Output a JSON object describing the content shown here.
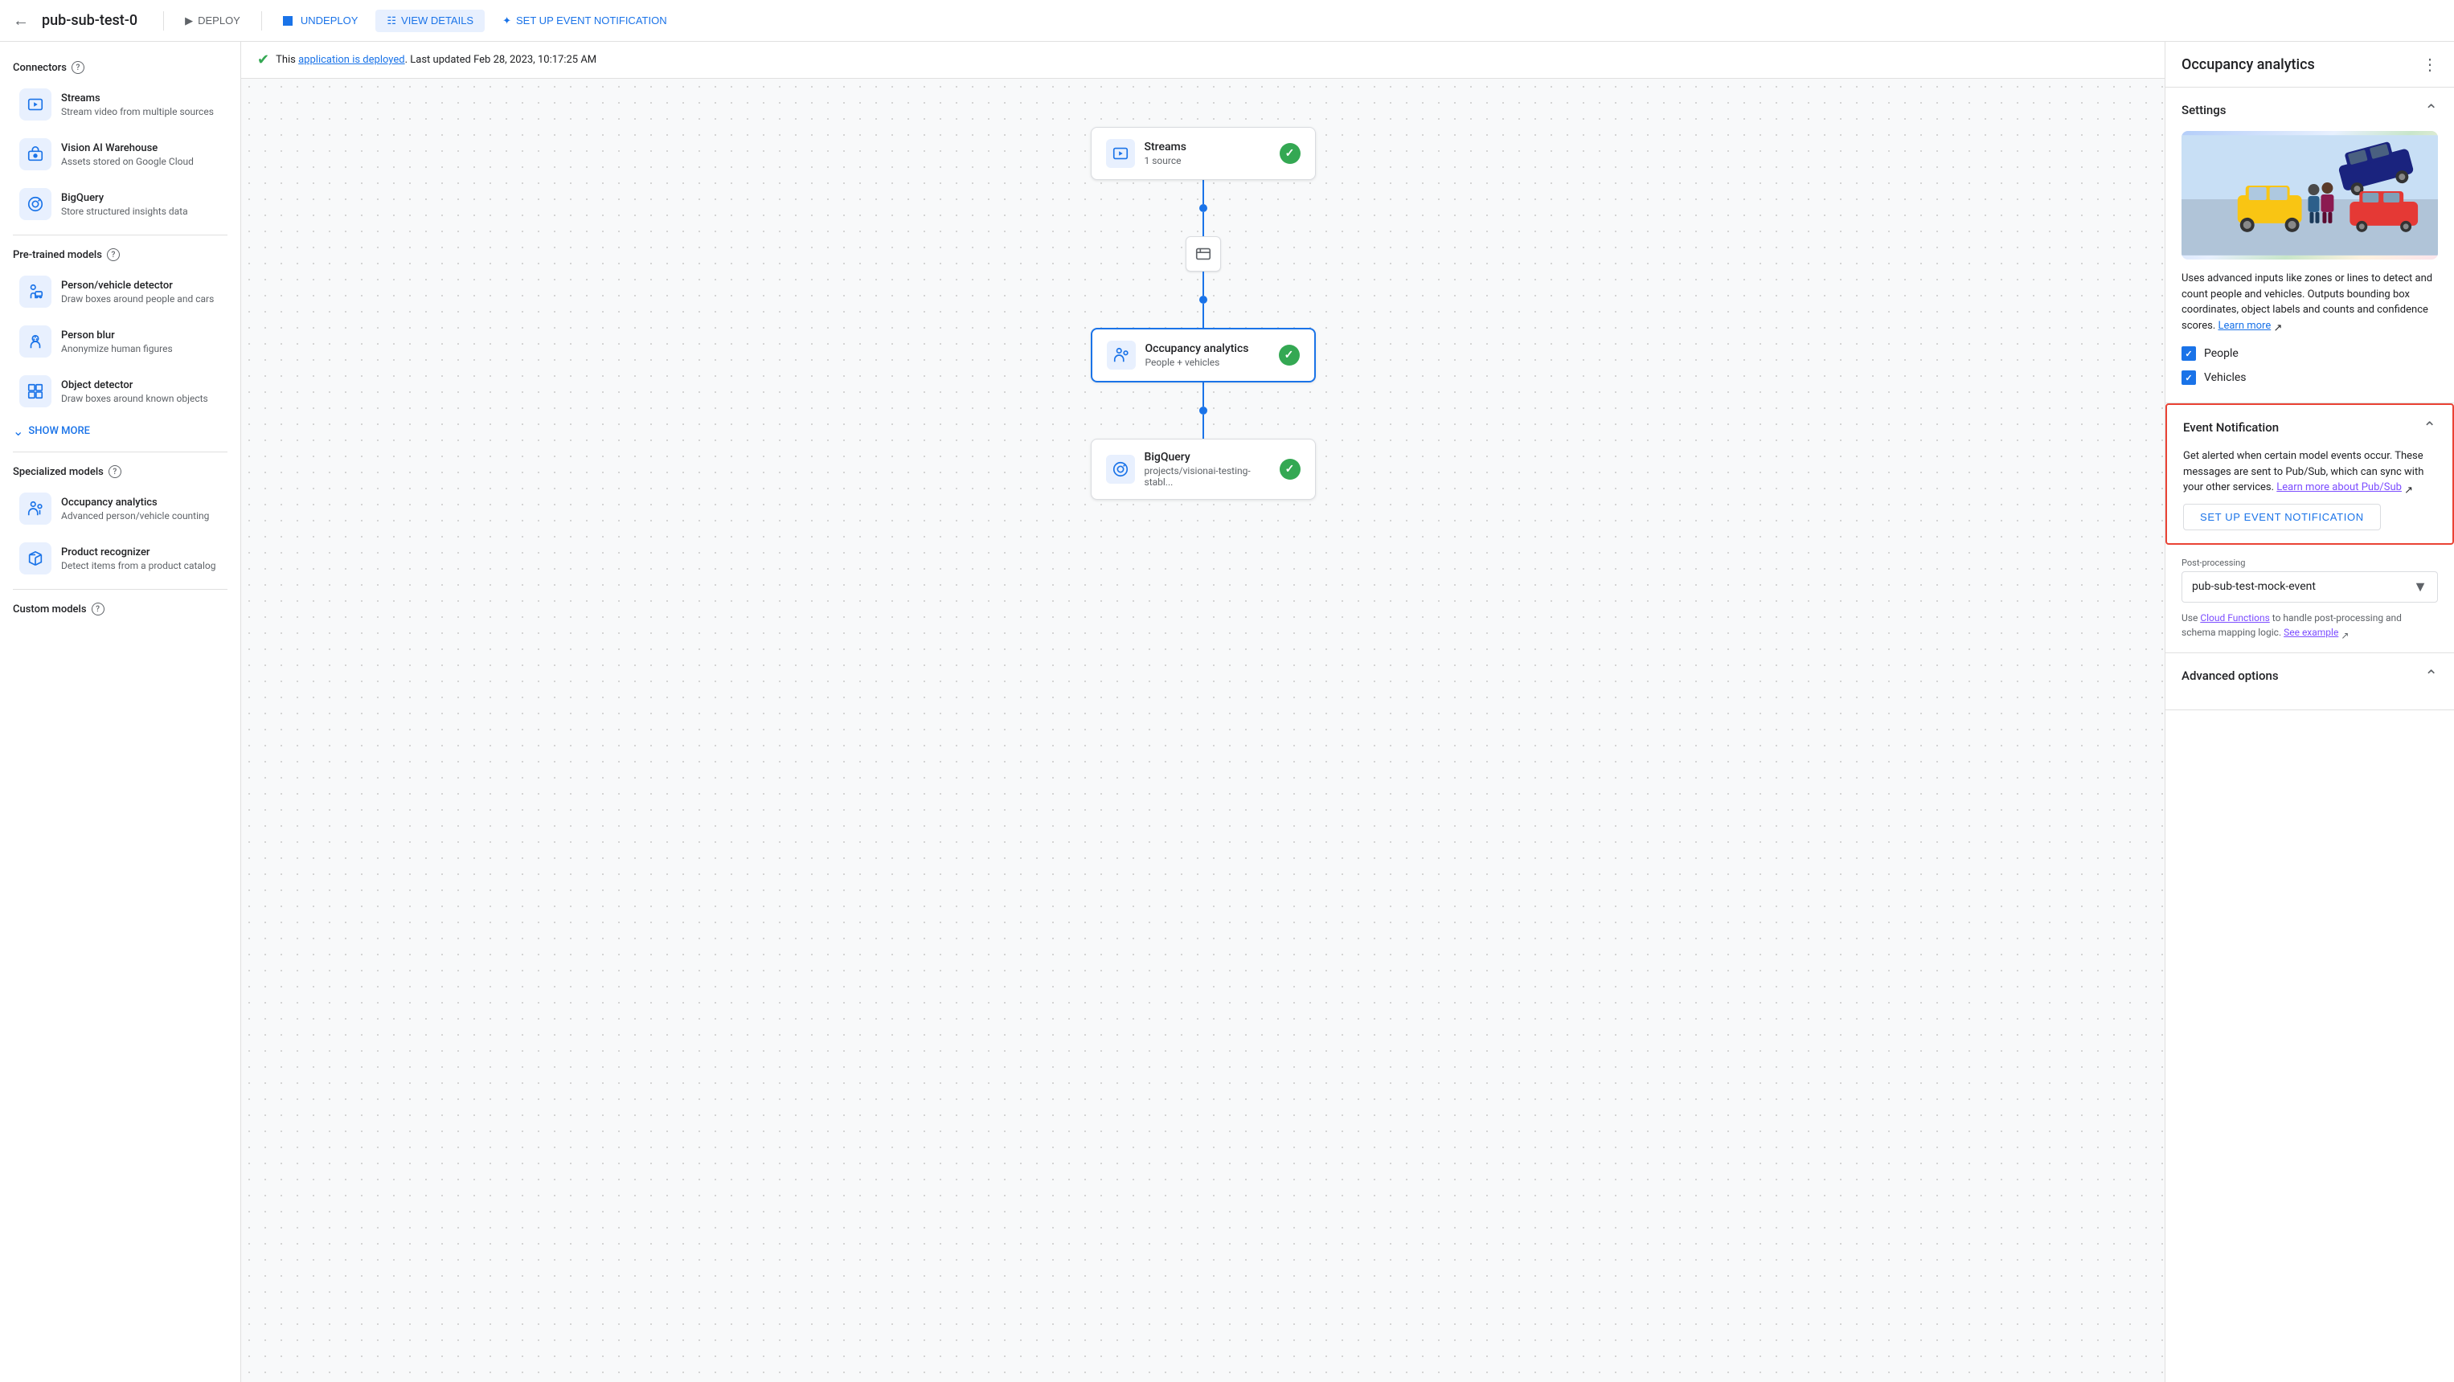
{
  "topbar": {
    "title": "pub-sub-test-0",
    "actions": {
      "deploy": "DEPLOY",
      "undeploy": "UNDEPLOY",
      "view_details": "VIEW DETAILS",
      "setup_event": "SET UP EVENT NOTIFICATION"
    }
  },
  "status": {
    "text": "This",
    "link": "application is deployed",
    "suffix": ". Last updated Feb 28, 2023, 10:17:25 AM"
  },
  "sidebar": {
    "connectors_title": "Connectors",
    "connectors": [
      {
        "name": "Streams",
        "desc": "Stream video from multiple sources",
        "icon": "streams"
      },
      {
        "name": "Vision AI Warehouse",
        "desc": "Assets stored on Google Cloud",
        "icon": "warehouse"
      },
      {
        "name": "BigQuery",
        "desc": "Store structured insights data",
        "icon": "bigquery"
      }
    ],
    "pretrained_title": "Pre-trained models",
    "pretrained": [
      {
        "name": "Person/vehicle detector",
        "desc": "Draw boxes around people and cars",
        "icon": "person-vehicle"
      },
      {
        "name": "Person blur",
        "desc": "Anonymize human figures",
        "icon": "person-blur"
      },
      {
        "name": "Object detector",
        "desc": "Draw boxes around known objects",
        "icon": "object-detector"
      }
    ],
    "show_more": "SHOW MORE",
    "specialized_title": "Specialized models",
    "specialized": [
      {
        "name": "Occupancy analytics",
        "desc": "Advanced person/vehicle counting",
        "icon": "occupancy"
      },
      {
        "name": "Product recognizer",
        "desc": "Detect items from a product catalog",
        "icon": "product"
      }
    ],
    "custom_title": "Custom models"
  },
  "canvas": {
    "nodes": [
      {
        "id": "streams",
        "name": "Streams",
        "sub": "1 source",
        "checked": true,
        "icon": "streams"
      },
      {
        "id": "occupancy",
        "name": "Occupancy analytics",
        "sub": "People + vehicles",
        "checked": true,
        "icon": "occupancy",
        "selected": true
      },
      {
        "id": "bigquery",
        "name": "BigQuery",
        "sub": "projects/visionai-testing-stabl...",
        "checked": true,
        "icon": "bigquery"
      }
    ]
  },
  "right_panel": {
    "title": "Occupancy analytics",
    "settings": {
      "title": "Settings",
      "desc_parts": [
        "Uses advanced inputs like zones or lines to detect and count people and vehicles. Outputs bounding box coordinates, object labels and counts and confidence scores.",
        " ",
        "Learn more"
      ],
      "checkboxes": [
        {
          "label": "People",
          "checked": true
        },
        {
          "label": "Vehicles",
          "checked": true
        }
      ]
    },
    "event_notification": {
      "title": "Event Notification",
      "desc": "Get alerted when certain model events occur. These messages are sent to Pub/Sub, which can sync with your other services.",
      "link_text": "Learn more about Pub/Sub",
      "button": "SET UP EVENT NOTIFICATION"
    },
    "post_processing": {
      "label": "Post-processing",
      "value": "pub-sub-test-mock-event",
      "note_parts": [
        "Use ",
        "Cloud Functions",
        " to handle post-processing and schema mapping logic. ",
        "See example"
      ]
    },
    "advanced_options": {
      "title": "Advanced options"
    }
  }
}
